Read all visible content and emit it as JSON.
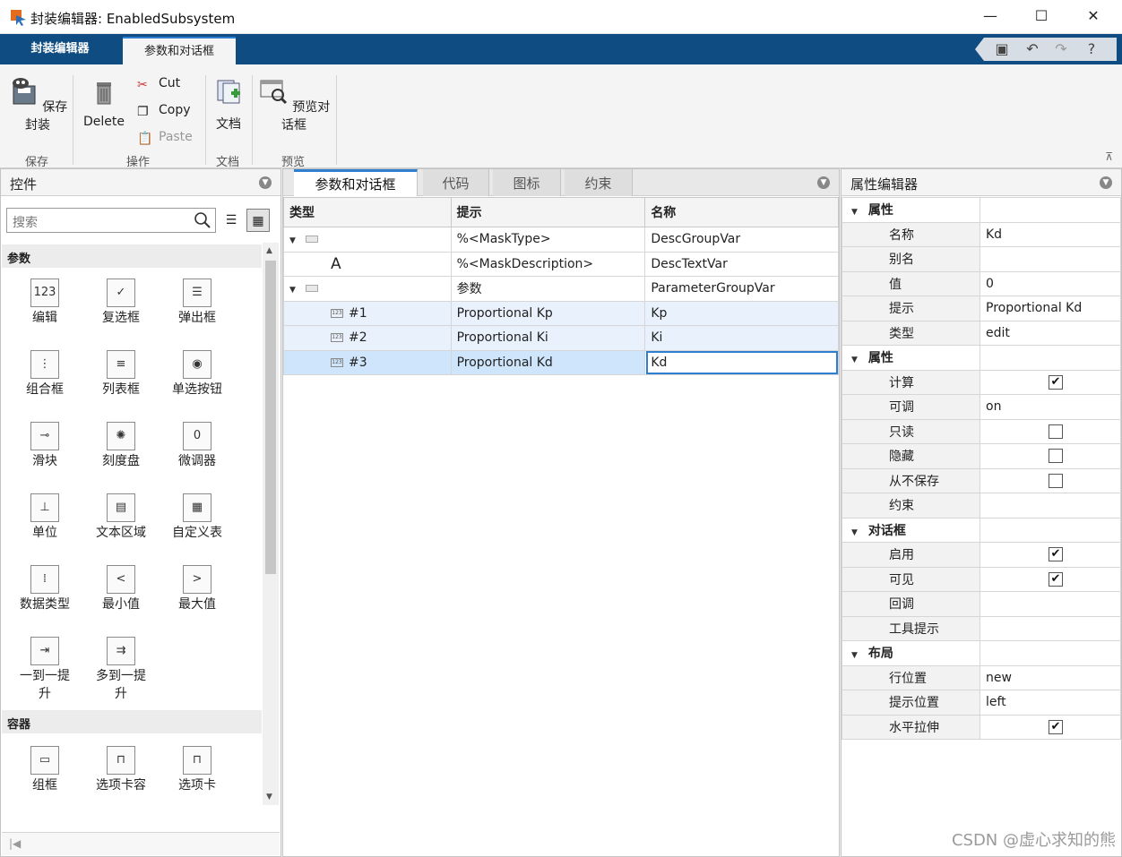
{
  "window": {
    "title": "封装编辑器: EnabledSubsystem",
    "controls": {
      "minimize": "—",
      "maximize": "☐",
      "close": "✕"
    }
  },
  "ribbon_tabs": {
    "mask": "封装编辑器",
    "params": "参数和对话框"
  },
  "quick_access": [
    "save-icon",
    "undo-icon",
    "redo-icon",
    "help-icon"
  ],
  "toolstrip": {
    "save_mask": "保存封装",
    "delete": "Delete",
    "cut": "Cut",
    "copy": "Copy",
    "paste": "Paste",
    "doc": "文档",
    "preview": "预览对话框",
    "groups": {
      "save": "保存",
      "ops": "操作",
      "doc": "文档",
      "preview": "预览"
    }
  },
  "left_panel": {
    "title": "控件",
    "search_placeholder": "搜索",
    "sections": {
      "params": "参数",
      "containers": "容器"
    },
    "controls": [
      {
        "label": "编辑",
        "glyph": "123"
      },
      {
        "label": "复选框",
        "glyph": "✓"
      },
      {
        "label": "弹出框",
        "glyph": "☰"
      },
      {
        "label": "组合框",
        "glyph": "⋮"
      },
      {
        "label": "列表框",
        "glyph": "≡"
      },
      {
        "label": "单选按钮",
        "glyph": "◉"
      },
      {
        "label": "滑块",
        "glyph": "⊸"
      },
      {
        "label": "刻度盘",
        "glyph": "✺"
      },
      {
        "label": "微调器",
        "glyph": "0"
      },
      {
        "label": "单位",
        "glyph": "⊥"
      },
      {
        "label": "文本区域",
        "glyph": "▤"
      },
      {
        "label": "自定义表",
        "glyph": "▦"
      },
      {
        "label": "数据类型",
        "glyph": "⁞"
      },
      {
        "label": "最小值",
        "glyph": "<"
      },
      {
        "label": "最大值",
        "glyph": ">"
      },
      {
        "label": "一到一提升",
        "glyph": "⇥"
      },
      {
        "label": "多到一提升",
        "glyph": "⇉"
      }
    ],
    "containers": [
      {
        "label": "组框",
        "glyph": "▭"
      },
      {
        "label": "选项卡容器",
        "glyph": "⊓"
      },
      {
        "label": "选项卡",
        "glyph": "⊓"
      }
    ],
    "scroll_start": "|◀"
  },
  "center_panel": {
    "tabs": [
      "参数和对话框",
      "代码",
      "图标",
      "约束"
    ],
    "columns": [
      "类型",
      "提示",
      "名称"
    ],
    "rows": [
      {
        "type": "",
        "prompt": "%<MaskType>",
        "name": "DescGroupVar"
      },
      {
        "type": "A",
        "prompt": "%<MaskDescription>",
        "name": "DescTextVar"
      },
      {
        "type": "",
        "prompt": "参数",
        "name": "ParameterGroupVar"
      },
      {
        "type": "#1",
        "prompt": "Proportional Kp",
        "name": "Kp"
      },
      {
        "type": "#2",
        "prompt": "Proportional Ki",
        "name": "Ki"
      },
      {
        "type": "#3",
        "prompt": "Proportional Kd",
        "name": "Kd"
      }
    ]
  },
  "right_panel": {
    "title": "属性编辑器",
    "groups": {
      "attr1": "属性",
      "attr2": "属性",
      "dialog": "对话框",
      "layout": "布局"
    },
    "props": {
      "name_k": "名称",
      "name_v": "Kd",
      "alias_k": "别名",
      "alias_v": "",
      "value_k": "值",
      "value_v": "0",
      "prompt_k": "提示",
      "prompt_v": "Proportional Kd",
      "type_k": "类型",
      "type_v": "edit",
      "evaluate_k": "计算",
      "tunable_k": "可调",
      "tunable_v": "on",
      "readonly_k": "只读",
      "hidden_k": "隐藏",
      "neversave_k": "从不保存",
      "constraint_k": "约束",
      "enabled_k": "启用",
      "visible_k": "可见",
      "callback_k": "回调",
      "tooltip_k": "工具提示",
      "rowpos_k": "行位置",
      "rowpos_v": "new",
      "promptpos_k": "提示位置",
      "promptpos_v": "left",
      "hstretch_k": "水平拉伸"
    },
    "checks": {
      "evaluate": "✔",
      "enabled": "✔",
      "visible": "✔",
      "hstretch": "✔"
    }
  },
  "watermark": "CSDN @虚心求知的熊"
}
